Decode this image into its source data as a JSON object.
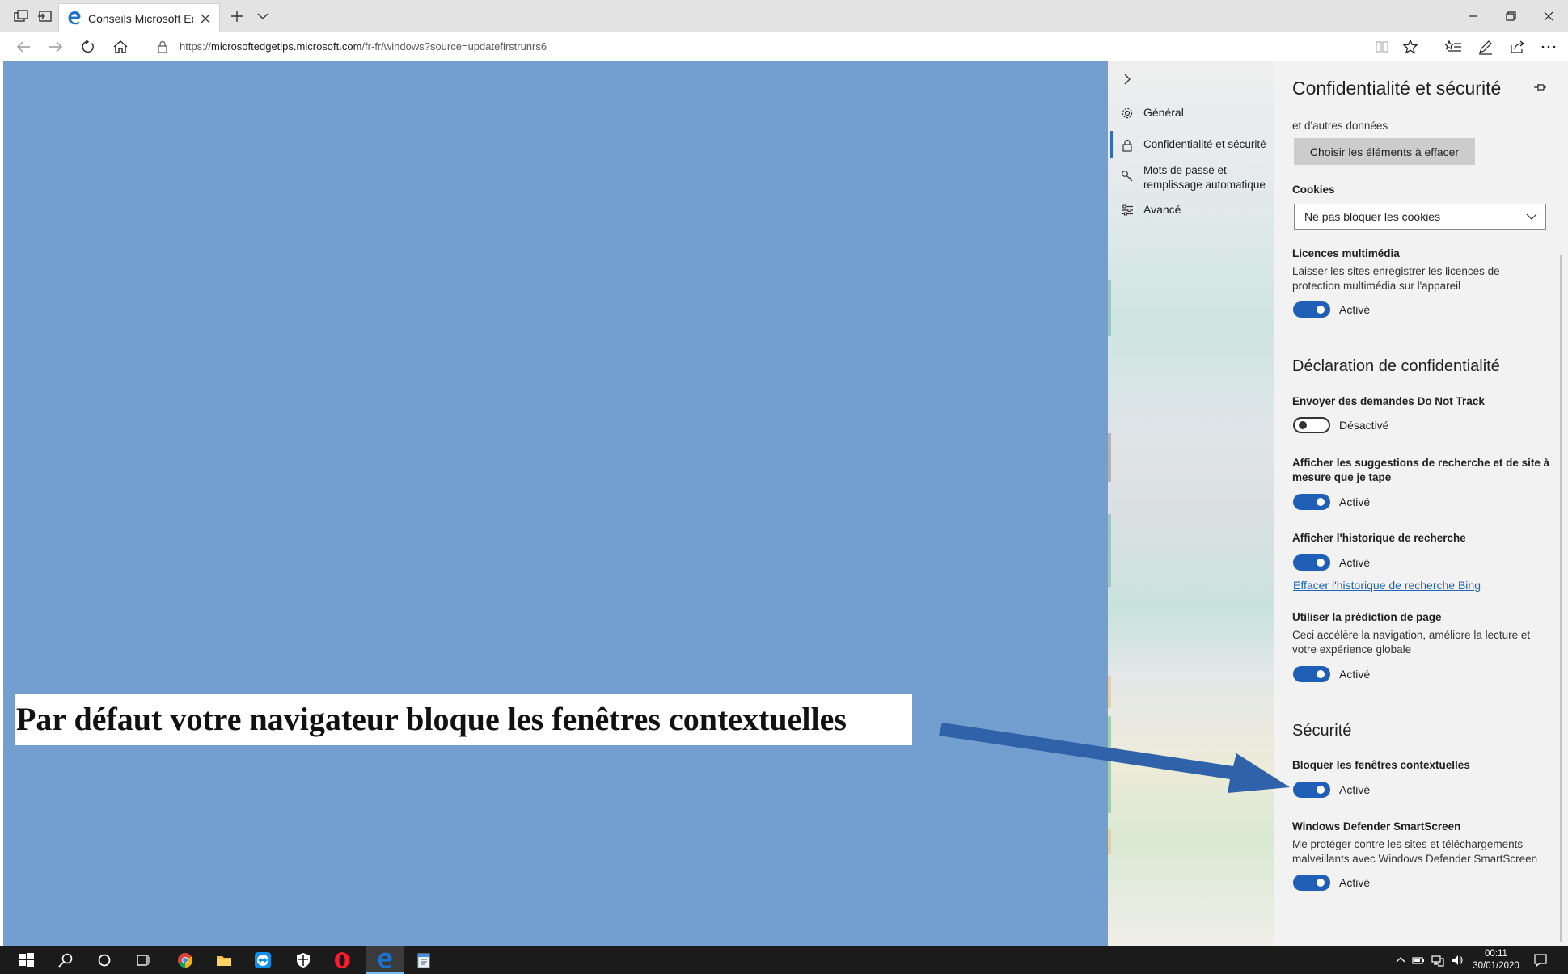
{
  "browser": {
    "tab_title": "Conseils Microsoft Edge",
    "url_prefix": "https://",
    "url_host": "microsoftedgetips.microsoft.com",
    "url_path": "/fr-fr/windows?source=updatefirstrunrs6",
    "accent_color": "#2b6cc4"
  },
  "nav_pane": {
    "items": [
      {
        "icon": "gear-icon",
        "label": "Général"
      },
      {
        "icon": "lock-icon",
        "label": "Confidentialité et sécurité"
      },
      {
        "icon": "key-icon",
        "label_line1": "Mots de passe et",
        "label_line2": "remplissage automatique"
      },
      {
        "icon": "sliders-icon",
        "label": "Avancé"
      }
    ]
  },
  "settings": {
    "title": "Confidentialité et sécurité",
    "clear_data_text": "et d'autres données",
    "clear_button": "Choisir les éléments à effacer",
    "cookies": {
      "label": "Cookies",
      "value": "Ne pas bloquer les cookies"
    },
    "media_licenses": {
      "label": "Licences multimédia",
      "desc_line1": "Laisser les sites enregistrer les licences de",
      "desc_line2": "protection multimédia sur l'appareil",
      "state": "Activé",
      "on": true
    },
    "privacy_section": "Déclaration de confidentialité",
    "do_not_track": {
      "label": "Envoyer des demandes Do Not Track",
      "state": "Désactivé",
      "on": false
    },
    "search_suggestions": {
      "label_line1": "Afficher les suggestions de recherche et de site à",
      "label_line2": "mesure que je tape",
      "state": "Activé",
      "on": true
    },
    "search_history": {
      "label": "Afficher l'historique de recherche",
      "state": "Activé",
      "on": true,
      "link": "Effacer l'historique de recherche Bing"
    },
    "page_prediction": {
      "label": "Utiliser la prédiction de page",
      "desc_line1": "Ceci accélère la navigation, améliore la lecture et",
      "desc_line2": "votre expérience globale",
      "state": "Activé",
      "on": true
    },
    "security_section": "Sécurité",
    "block_popups": {
      "label": "Bloquer les fenêtres contextuelles",
      "state": "Activé",
      "on": true
    },
    "smartscreen": {
      "label": "Windows Defender SmartScreen",
      "desc_line1": "Me protéger contre les sites et téléchargements",
      "desc_line2": "malveillants avec Windows Defender SmartScreen",
      "state": "Activé",
      "on": true
    }
  },
  "annotation": {
    "text": "Par défaut votre navigateur bloque les fenêtres contextuelles",
    "arrow_color": "#2f62a8"
  },
  "taskbar": {
    "time": "00:11",
    "date": "30/01/2020"
  }
}
